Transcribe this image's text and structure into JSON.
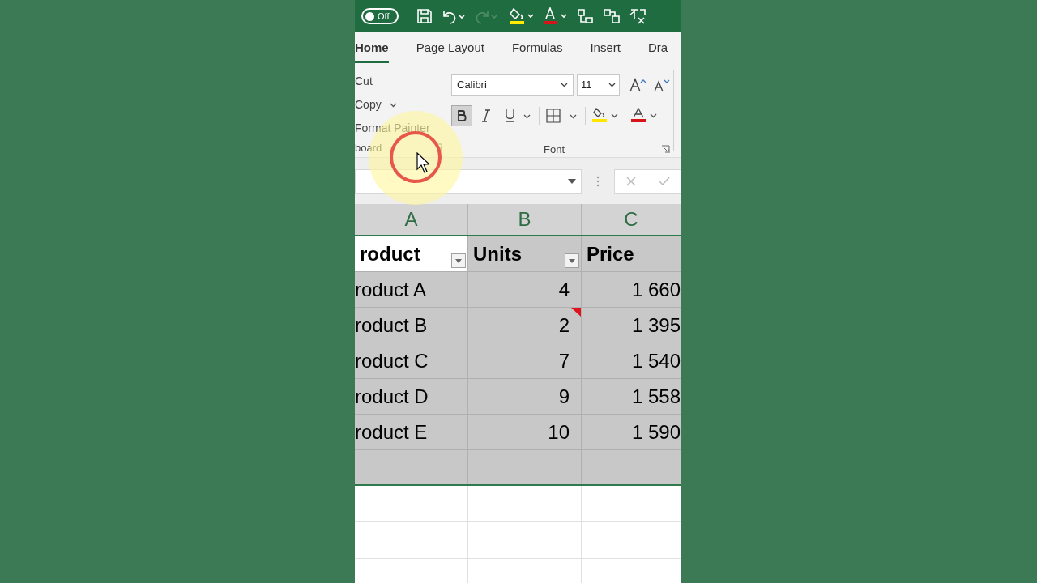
{
  "title_bar": {
    "autosave": {
      "label": "Off",
      "on": false
    },
    "redo_disabled": true
  },
  "tabs": [
    {
      "label": "Home",
      "selected": true
    },
    {
      "label": "Page Layout",
      "selected": false
    },
    {
      "label": "Formulas",
      "selected": false
    },
    {
      "label": "Insert",
      "selected": false
    },
    {
      "label": "Dra",
      "selected": false
    }
  ],
  "clipboard": {
    "items": [
      {
        "label": "Cut",
        "dropdown": false
      },
      {
        "label": "Copy",
        "dropdown": true
      },
      {
        "label": "Format Painter",
        "dropdown": false
      }
    ],
    "group_label": "board"
  },
  "font": {
    "name": "Calibri",
    "size": "11",
    "bold": true,
    "group_label": "Font"
  },
  "columns": [
    "A",
    "B",
    "C"
  ],
  "table": {
    "headers": [
      "roduct",
      "Units",
      "Price"
    ],
    "rows": [
      {
        "product": "roduct A",
        "units": "4",
        "price": "1 660",
        "comment": false
      },
      {
        "product": "roduct B",
        "units": "2",
        "price": "1 395",
        "comment": true
      },
      {
        "product": "roduct C",
        "units": "7",
        "price": "1 540",
        "comment": false
      },
      {
        "product": "roduct D",
        "units": "9",
        "price": "1 558",
        "comment": false
      },
      {
        "product": "roduct E",
        "units": "10",
        "price": "1 590",
        "comment": false
      }
    ]
  }
}
